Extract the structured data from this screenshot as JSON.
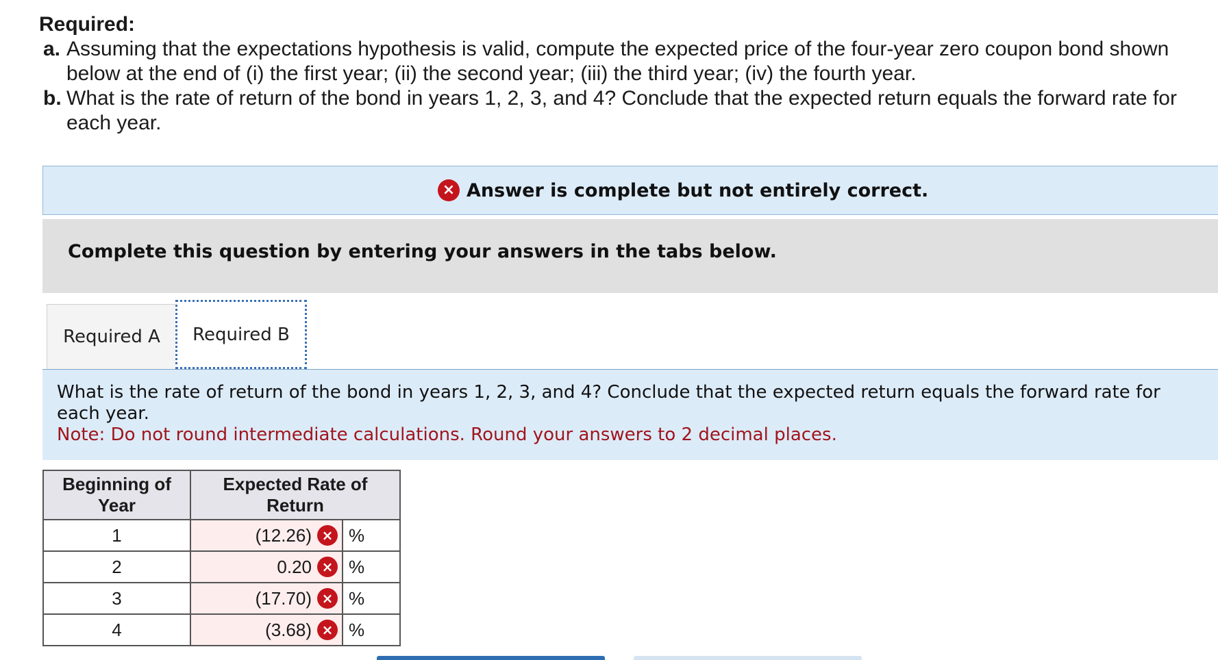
{
  "required": {
    "title": "Required:",
    "items": [
      {
        "label": "a.",
        "text": "Assuming that the expectations hypothesis is valid, compute the expected price of the four-year zero coupon bond shown below at the end of (i) the first year; (ii) the second year; (iii) the third year; (iv) the fourth year."
      },
      {
        "label": "b.",
        "text": "What is the rate of return of the bond in years 1, 2, 3, and 4? Conclude that the expected return equals the forward rate for each year."
      }
    ]
  },
  "banner": {
    "icon": "x-circle-icon",
    "text": "Answer is complete but not entirely correct.",
    "color": "#c4141c"
  },
  "instruction": {
    "text": "Complete this question by entering your answers in the tabs below."
  },
  "tabs": [
    {
      "label": "Required A",
      "active": false
    },
    {
      "label": "Required B",
      "active": true
    }
  ],
  "question": {
    "text": "What is the rate of return of the bond in years 1, 2, 3, and 4? Conclude that the expected return equals the forward rate for each year.",
    "note": "Note: Do not round intermediate calculations. Round your answers to 2 decimal places."
  },
  "table": {
    "headers": {
      "col1": "Beginning of Year",
      "col2": "Expected Rate of Return"
    },
    "rows": [
      {
        "year": "1",
        "value": "(12.26)",
        "unit": "%",
        "status": "incorrect"
      },
      {
        "year": "2",
        "value": "0.20",
        "unit": "%",
        "status": "incorrect"
      },
      {
        "year": "3",
        "value": "(17.70)",
        "unit": "%",
        "status": "incorrect"
      },
      {
        "year": "4",
        "value": "(3.68)",
        "unit": "%",
        "status": "incorrect"
      }
    ]
  },
  "incorrect_mark": "×"
}
